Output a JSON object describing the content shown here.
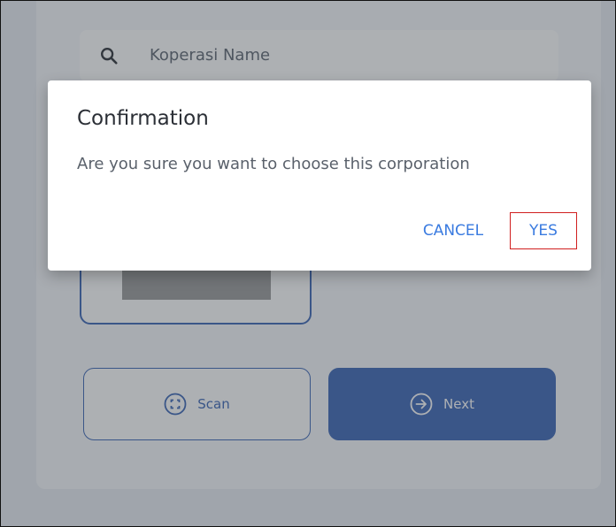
{
  "search": {
    "placeholder": "Koperasi Name",
    "icon": "search-icon"
  },
  "buttons": {
    "scan_label": "Scan",
    "next_label": "Next"
  },
  "dialog": {
    "title": "Confirmation",
    "message": "Are you sure you want to choose this corporation",
    "cancel_label": "CANCEL",
    "confirm_label": "YES"
  },
  "colors": {
    "accent": "#3a64b5",
    "dialog_action": "#3a7be0",
    "highlight": "#d01f1f"
  }
}
